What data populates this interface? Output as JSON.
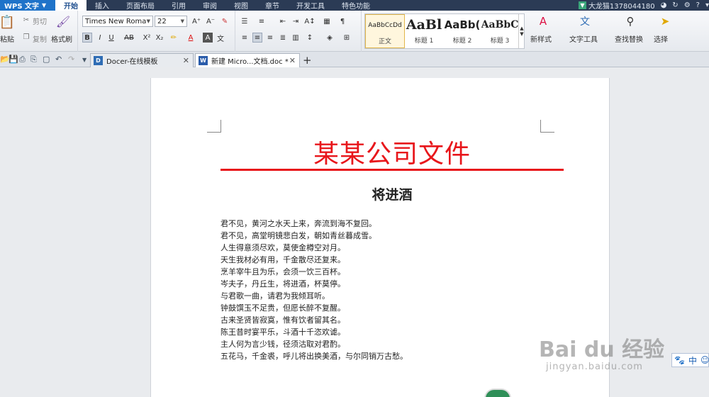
{
  "menubar": {
    "app_label": "WPS 文字",
    "tabs": [
      "开始",
      "插入",
      "页面布局",
      "引用",
      "审阅",
      "视图",
      "章节",
      "开发工具",
      "特色功能"
    ],
    "user": "大龙猫1378044180",
    "help_label": "?"
  },
  "ribbon": {
    "clipboard": {
      "paste": "粘贴",
      "cut": "剪切",
      "copy": "复制",
      "format_painter": "格式刷"
    },
    "font": {
      "name": "Times New Roma",
      "size": "22"
    },
    "styles": [
      {
        "sample": "AaBbCcDd",
        "name": "正文"
      },
      {
        "sample": "AaBl",
        "name": "标题 1"
      },
      {
        "sample": "AaBb(",
        "name": "标题 2"
      },
      {
        "sample": "AaBbC",
        "name": "标题 3"
      }
    ],
    "new_style": "新样式",
    "text_tools": "文字工具",
    "find_replace": "查找替换",
    "select": "选择"
  },
  "tabs": [
    {
      "label": "Docer-在线模板",
      "icon": "D"
    },
    {
      "label": "新建 Micro...文档.doc *",
      "icon": "W"
    }
  ],
  "document": {
    "heading": "某某公司文件",
    "poem_title": "将进酒",
    "lines": [
      "君不见，黄河之水天上来，奔流到海不复回。",
      "君不见，高堂明镜悲白发，朝如青丝暮成雪。",
      "人生得意须尽欢，莫使金樽空对月。",
      "天生我材必有用，千金散尽还复来。",
      "烹羊宰牛且为乐，会须一饮三百杯。",
      "岑夫子，丹丘生，将进酒，杯莫停。",
      "与君歌一曲，请君为我倾耳听。",
      "钟鼓馔玉不足贵，但愿长醉不复醒。",
      "古来圣贤皆寂寞，惟有饮者留其名。",
      "陈王昔时宴平乐，斗酒十千恣欢谑。",
      "主人何为言少钱，径须沽取对君酌。",
      "五花马，千金裘，呼儿将出换美酒，与尔同销万古愁。"
    ]
  },
  "ime": {
    "lang": "中"
  },
  "watermark": {
    "main": "Bai du 经验",
    "sub": "jingyan.baidu.com"
  },
  "colors": {
    "heading_red": "#e8161b",
    "menubar_bg": "#2b3b55",
    "app_blue": "#1f73c9"
  }
}
